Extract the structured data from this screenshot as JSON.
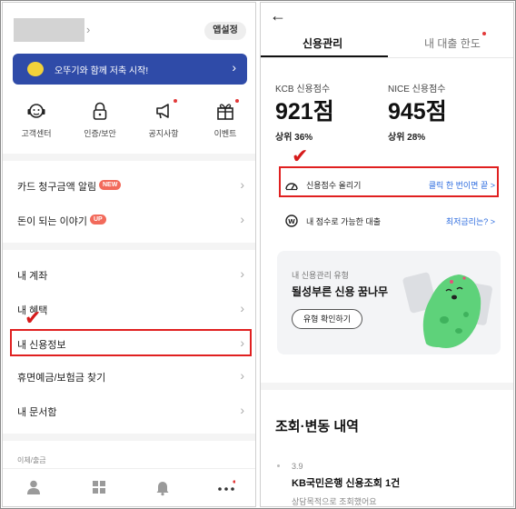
{
  "left": {
    "header": {
      "settings_label": "앱설정"
    },
    "promo": {
      "text": "오뚜기와 함께 저축 시작!"
    },
    "quick_menu": [
      {
        "icon": "headset-icon",
        "label": "고객센터"
      },
      {
        "icon": "lock-icon",
        "label": "인증/보안"
      },
      {
        "icon": "megaphone-icon",
        "label": "공지사항"
      },
      {
        "icon": "gift-icon",
        "label": "이벤트"
      }
    ],
    "menu": [
      {
        "label": "카드 청구금액 알림",
        "badge": "NEW"
      },
      {
        "label": "돈이 되는 이야기",
        "badge": "UP"
      },
      {
        "label": "내 계좌"
      },
      {
        "label": "내 혜택"
      },
      {
        "label": "내 신용정보"
      },
      {
        "label": "휴면예금/보험금 찾기"
      },
      {
        "label": "내 문서함"
      }
    ],
    "section_caption": "이체/출금",
    "colors": {
      "promo_bg": "#2f4ba8",
      "badge": "#f26a5b",
      "highlight": "#e02020"
    }
  },
  "right": {
    "tabs": [
      {
        "label": "신용관리"
      },
      {
        "label": "내 대출 한도"
      }
    ],
    "kcb": {
      "label": "KCB 신용점수",
      "score": "921점",
      "rank": "상위 36%"
    },
    "nice": {
      "label": "NICE 신용점수",
      "score": "945점",
      "rank": "상위 28%"
    },
    "raise_score": {
      "label": "신용점수 올리기",
      "link": "클릭 한 번이면 끝 >"
    },
    "loan_row": {
      "label": "내 점수로 가능한 대출",
      "link": "최저금리는? >"
    },
    "type_card": {
      "subtitle": "내 신용관리 유형",
      "title": "될성부른 신용 꿈나무",
      "button": "유형 확인하기"
    },
    "history": {
      "title": "조회·변동 내역",
      "items": [
        {
          "date": "3.9",
          "title": "KB국민은행 신용조회 1건",
          "desc": "상담목적으로 조회했어요"
        }
      ]
    },
    "colors": {
      "link": "#2d6cdf",
      "mascot": "#5ed27a"
    }
  }
}
